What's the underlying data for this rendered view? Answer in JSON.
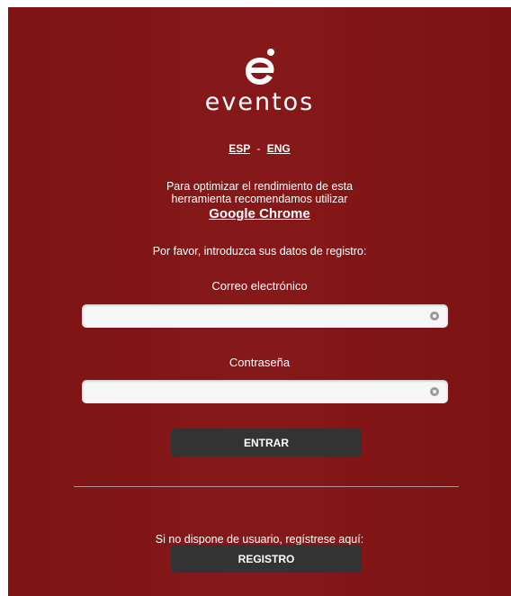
{
  "brand": {
    "name": "eventos"
  },
  "lang": {
    "esp": "ESP",
    "separator": "-",
    "eng": "ENG"
  },
  "notice": {
    "line1": "Para optimizar el rendimiento de esta",
    "line2": "herramienta recomendamos utilizar",
    "browser_link": "Google Chrome"
  },
  "intro": "Por favor, introduzca sus datos de registro:",
  "email": {
    "label": "Correo electrónico",
    "value": "",
    "icon": "key-icon"
  },
  "password": {
    "label": "Contraseña",
    "value": "",
    "icon": "key-icon"
  },
  "login_button": "ENTRAR",
  "register": {
    "prompt": "Si no dispone de usuario, regístrese aquí:",
    "button": "REGISTRO"
  },
  "colors": {
    "panel": "#861819",
    "button": "#333333",
    "text": "#ffffff"
  }
}
